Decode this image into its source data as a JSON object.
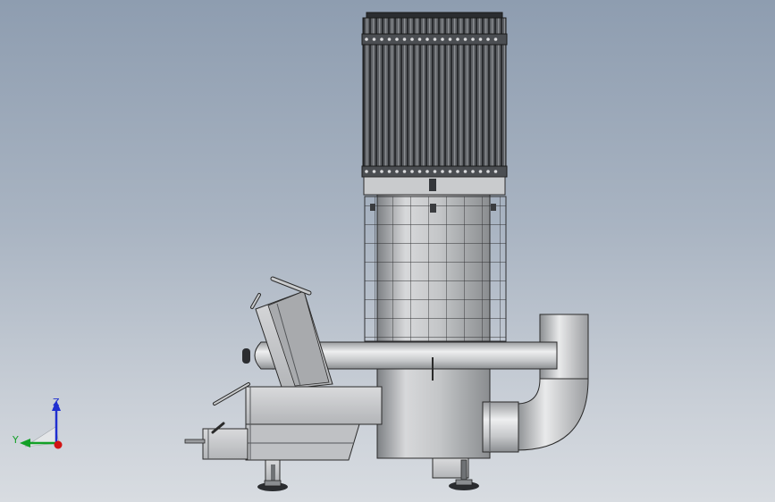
{
  "viewport": {
    "background_top": "#8e9db0",
    "background_bottom": "#d8dce1"
  },
  "model": {
    "steel_light": "#e2e3e5",
    "steel_mid": "#b9bbbe",
    "steel_dark": "#6f7275",
    "outline": "#2a2a2a",
    "radiator_dark": "#3a3c3f"
  },
  "triad": {
    "z_label": "Z",
    "y_label": "Y",
    "z_color": "#1f2fd0",
    "y_color": "#13a027",
    "x_color": "#d21414"
  }
}
